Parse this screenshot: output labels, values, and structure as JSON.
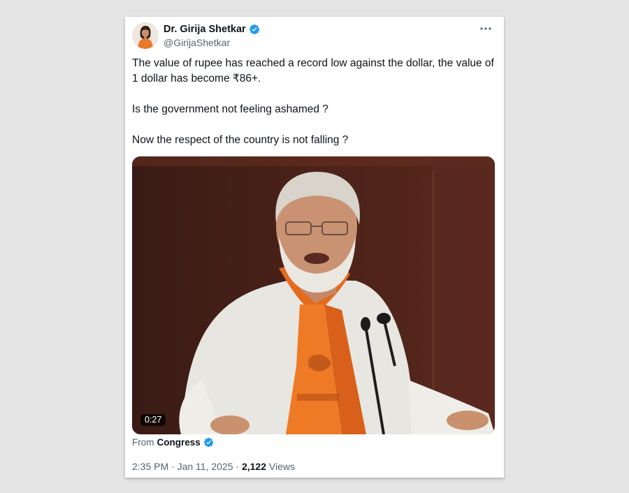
{
  "author": {
    "name": "Dr. Girija Shetkar",
    "handle": "@GirijaShetkar",
    "verified": true
  },
  "tweet": {
    "paragraphs": [
      "The value of rupee has reached a record low against the dollar, the value of 1 dollar has become ₹86+.",
      "Is the government not feeling ashamed ?",
      "Now the respect of the country is not falling ?"
    ]
  },
  "media": {
    "type": "video",
    "duration": "0:27"
  },
  "source": {
    "label": "From",
    "name": "Congress",
    "verified": true
  },
  "meta": {
    "time": "2:35 PM",
    "separator": "·",
    "date": "Jan 11, 2025",
    "views_count": "2,122",
    "views_label": "Views"
  },
  "icons": {
    "verified": "verified-badge-icon",
    "more": "more-options-icon"
  },
  "colors": {
    "verified_blue": "#1d9bf0",
    "secondary_text": "#536471",
    "primary_text": "#0f1419",
    "background": "#e4e4e4"
  }
}
